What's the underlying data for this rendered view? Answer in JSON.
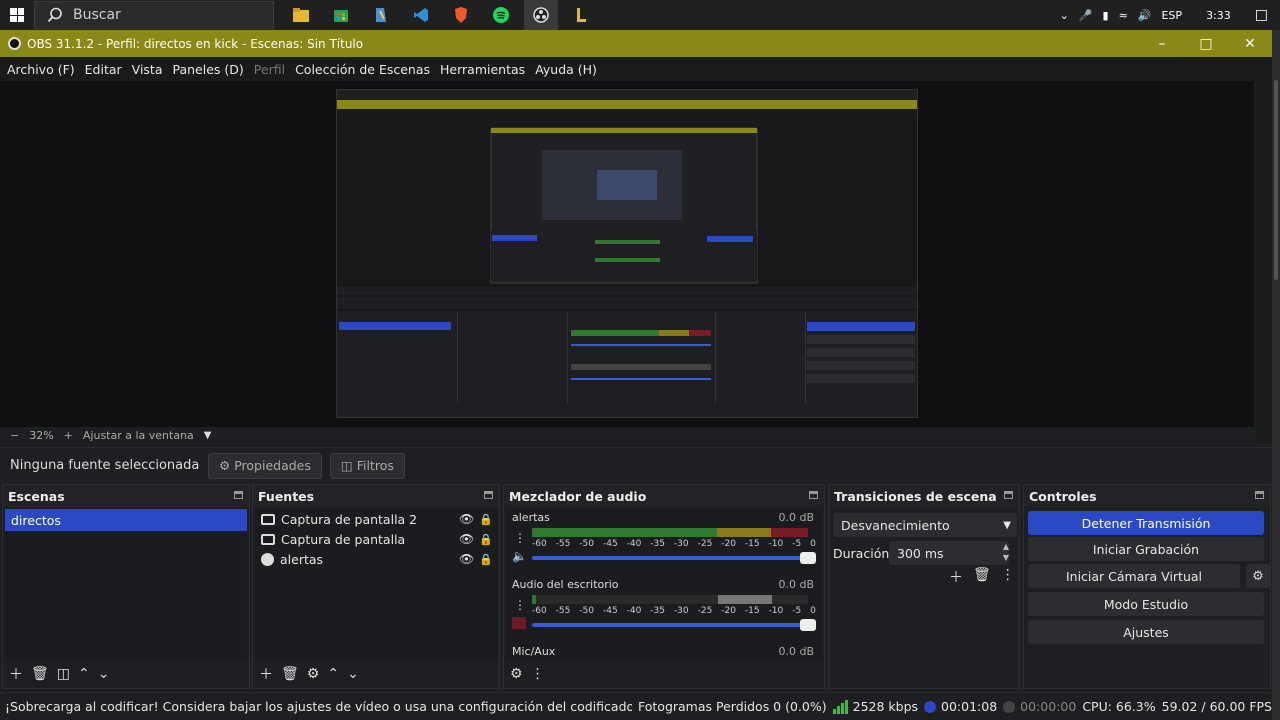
{
  "taskbar": {
    "search_placeholder": "Buscar",
    "tray_lang": "ESP",
    "tray_time": "3:33"
  },
  "window": {
    "title": "OBS 31.1.2 - Perfil: directos en kick - Escenas: Sin Título",
    "accent_color": "#8a8817"
  },
  "menu": [
    "Archivo (F)",
    "Editar",
    "Vista",
    "Paneles (D)",
    "Perfil",
    "Colección de Escenas",
    "Herramientas",
    "Ayuda (H)"
  ],
  "zoom": {
    "minus": "−",
    "level": "32%",
    "plus": "+",
    "fit_label": "Ajustar a la ventana"
  },
  "source_bar": {
    "none_selected": "Ninguna fuente seleccionada",
    "properties": "Propiedades",
    "filters": "Filtros"
  },
  "scenes": {
    "title": "Escenas",
    "items": [
      "directos"
    ]
  },
  "sources": {
    "title": "Fuentes",
    "items": [
      {
        "label": "Captura de pantalla 2",
        "icon": "monitor-icon"
      },
      {
        "label": "Captura de pantalla",
        "icon": "monitor-icon"
      },
      {
        "label": "alertas",
        "icon": "browser-icon"
      }
    ]
  },
  "mixer": {
    "title": "Mezclador de audio",
    "ticks": [
      "-60",
      "-55",
      "-50",
      "-45",
      "-40",
      "-35",
      "-30",
      "-25",
      "-20",
      "-15",
      "-10",
      "-5",
      "0"
    ],
    "channels": [
      {
        "name": "alertas",
        "db": "0.0 dB"
      },
      {
        "name": "Audio del escritorio",
        "db": "0.0 dB"
      },
      {
        "name": "Mic/Aux",
        "db": "0.0 dB"
      }
    ]
  },
  "transitions": {
    "title": "Transiciones de escena",
    "selected": "Desvanecimiento",
    "duration_label": "Duración",
    "duration_value": "300 ms"
  },
  "controls": {
    "title": "Controles",
    "stop_stream": "Detener Transmisión",
    "start_recording": "Iniciar Grabación",
    "virtual_cam": "Iniciar Cámara Virtual",
    "studio_mode": "Modo Estudio",
    "settings": "Ajustes",
    "primary_color": "#2b49c5"
  },
  "status": {
    "warning": "¡Sobrecarga al codificar! Considera bajar los ajustes de vídeo o usa una configuración del codificador más rápida.",
    "dropped_frames": "Fotogramas Perdidos 0 (0.0%)",
    "bitrate": "2528 kbps",
    "stream_time": "00:01:08",
    "rec_time": "00:00:00",
    "cpu": "CPU: 66.3%",
    "fps": "59.02 / 60.00 FPS"
  }
}
